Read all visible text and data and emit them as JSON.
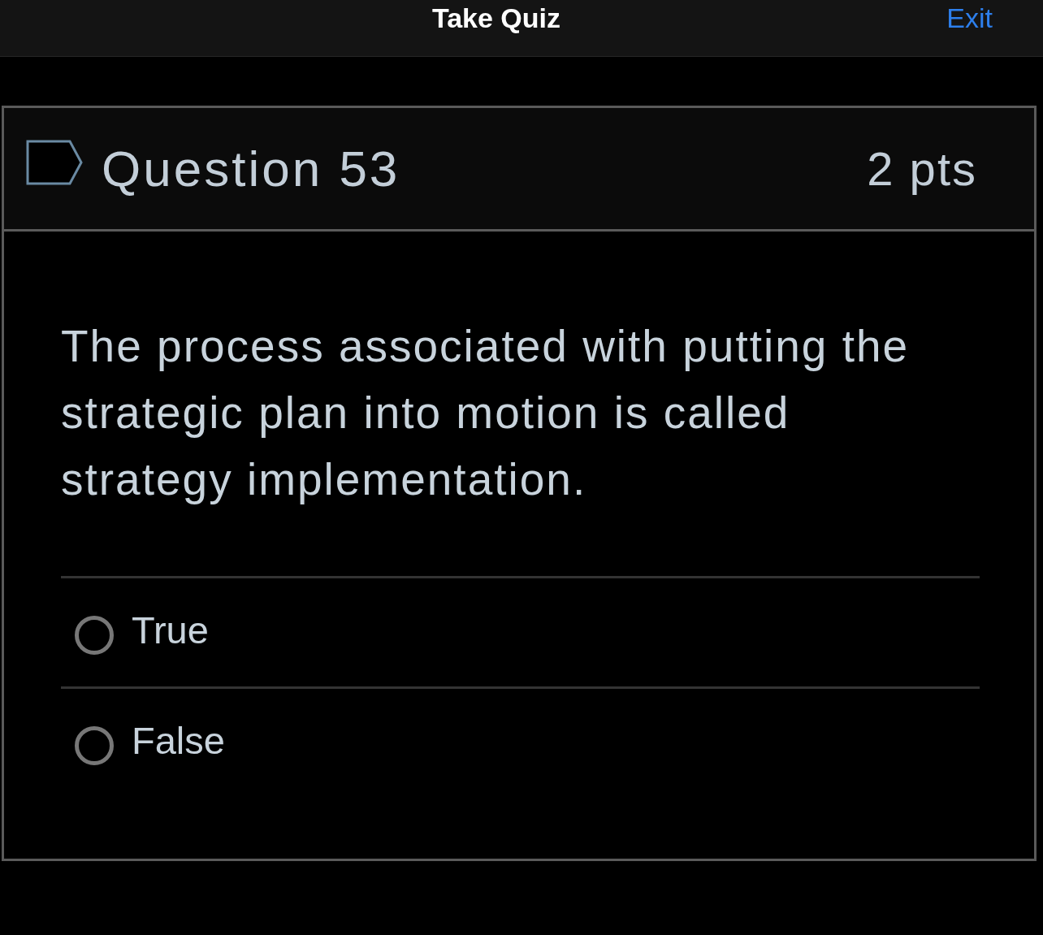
{
  "header": {
    "title": "Take Quiz",
    "exit": "Exit"
  },
  "question": {
    "flagged": false,
    "title": "Question 53",
    "points": "2 pts",
    "text": "The process associated with putting the strategic plan into motion is called strategy implementation.",
    "answers": [
      {
        "label": "True",
        "selected": false
      },
      {
        "label": "False",
        "selected": false
      }
    ]
  }
}
